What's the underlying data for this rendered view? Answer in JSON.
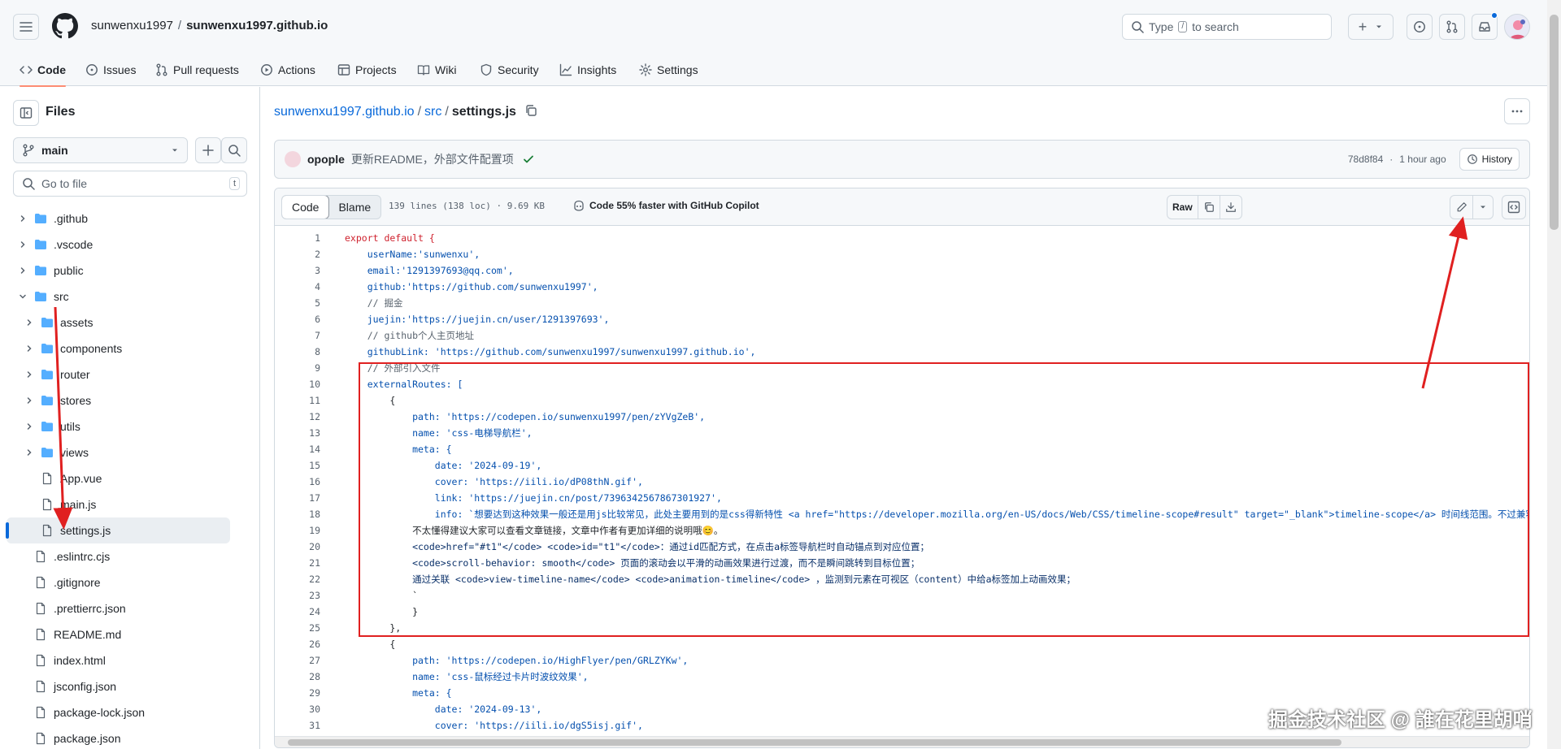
{
  "header": {
    "owner": "sunwenxu1997",
    "separator": "/",
    "repo": "sunwenxu1997.github.io",
    "search_placeholder_before": "Type",
    "search_key": "/",
    "search_placeholder_after": "to search",
    "new_button": "+"
  },
  "repo_nav": {
    "tabs": [
      {
        "label": "Code",
        "icon": "code-icon"
      },
      {
        "label": "Issues",
        "icon": "issue-icon"
      },
      {
        "label": "Pull requests",
        "icon": "pull-request-icon"
      },
      {
        "label": "Actions",
        "icon": "play-icon"
      },
      {
        "label": "Projects",
        "icon": "table-icon"
      },
      {
        "label": "Wiki",
        "icon": "book-icon"
      },
      {
        "label": "Security",
        "icon": "shield-icon"
      },
      {
        "label": "Insights",
        "icon": "graph-icon"
      },
      {
        "label": "Settings",
        "icon": "gear-icon"
      }
    ],
    "active": "Code"
  },
  "sidebar": {
    "title": "Files",
    "branch": "main",
    "go_to_file": "Go to file",
    "go_to_file_key": "t",
    "tree": [
      {
        "name": ".github",
        "type": "folder",
        "state": "collapsed"
      },
      {
        "name": ".vscode",
        "type": "folder",
        "state": "collapsed"
      },
      {
        "name": "public",
        "type": "folder",
        "state": "collapsed"
      },
      {
        "name": "src",
        "type": "folder",
        "state": "expanded"
      },
      {
        "name": "assets",
        "type": "folder",
        "state": "collapsed"
      },
      {
        "name": "components",
        "type": "folder",
        "state": "collapsed"
      },
      {
        "name": "router",
        "type": "folder",
        "state": "collapsed"
      },
      {
        "name": "stores",
        "type": "folder",
        "state": "collapsed"
      },
      {
        "name": "utils",
        "type": "folder",
        "state": "collapsed"
      },
      {
        "name": "views",
        "type": "folder",
        "state": "collapsed"
      },
      {
        "name": "App.vue",
        "type": "file"
      },
      {
        "name": "main.js",
        "type": "file"
      },
      {
        "name": "settings.js",
        "type": "file",
        "selected": true
      },
      {
        "name": ".eslintrc.cjs",
        "type": "file"
      },
      {
        "name": ".gitignore",
        "type": "file"
      },
      {
        "name": ".prettierrc.json",
        "type": "file"
      },
      {
        "name": "README.md",
        "type": "file"
      },
      {
        "name": "index.html",
        "type": "file"
      },
      {
        "name": "jsconfig.json",
        "type": "file"
      },
      {
        "name": "package-lock.json",
        "type": "file"
      },
      {
        "name": "package.json",
        "type": "file"
      }
    ]
  },
  "main": {
    "path": {
      "root": "sunwenxu1997.github.io",
      "dir": "src",
      "file": "settings.js",
      "sep": "/"
    },
    "commit": {
      "author": "opople",
      "message": "更新README，外部文件配置项",
      "hash": "78d8f84",
      "dot": "·",
      "time": "1 hour ago",
      "history": "History"
    },
    "file": {
      "tab_code": "Code",
      "tab_blame": "Blame",
      "info": "139 lines (138 loc) · 9.69 KB",
      "copilot": "Code 55% faster with GitHub Copilot",
      "raw": "Raw"
    },
    "code_lines": [
      {
        "n": "1",
        "t": "export default {"
      },
      {
        "n": "2",
        "t": "    userName:'sunwenxu',"
      },
      {
        "n": "3",
        "t": "    email:'1291397693@qq.com',"
      },
      {
        "n": "4",
        "t": "    github:'https://github.com/sunwenxu1997',"
      },
      {
        "n": "5",
        "t": "    // 掘金"
      },
      {
        "n": "6",
        "t": "    juejin:'https://juejin.cn/user/1291397693',"
      },
      {
        "n": "7",
        "t": "    // github个人主页地址"
      },
      {
        "n": "8",
        "t": "    githubLink: 'https://github.com/sunwenxu1997/sunwenxu1997.github.io',"
      },
      {
        "n": "9",
        "t": "    // 外部引入文件"
      },
      {
        "n": "10",
        "t": "    externalRoutes: ["
      },
      {
        "n": "11",
        "t": "        {"
      },
      {
        "n": "12",
        "t": "            path: 'https://codepen.io/sunwenxu1997/pen/zYVgZeB',"
      },
      {
        "n": "13",
        "t": "            name: 'css-电梯导航栏',"
      },
      {
        "n": "14",
        "t": "            meta: {"
      },
      {
        "n": "15",
        "t": "                date: '2024-09-19',"
      },
      {
        "n": "16",
        "t": "                cover: 'https://iili.io/dP08thN.gif',"
      },
      {
        "n": "17",
        "t": "                link: 'https://juejin.cn/post/7396342567867301927',"
      },
      {
        "n": "18",
        "t": "                info: `想要达到这种效果一般还是用js比较常见，此处主要用到的是css得新特性 <a href=\"https://developer.mozilla.org/en-US/docs/Web/CSS/timeline-scope#result\" target=\"_blank\">timeline-scope</a> 时间线范围。不过兼容性"
      },
      {
        "n": "19",
        "t": "            不太懂得建议大家可以查看文章链接，文章中作者有更加详细的说明哦😊。"
      },
      {
        "n": "20",
        "t": "            <code>href=\"#t1\"</code> <code>id=\"t1\"</code>：通过id匹配方式，在点击a标签导航栏时自动锚点到对应位置；"
      },
      {
        "n": "21",
        "t": "            <code>scroll-behavior: smooth</code> 页面的滚动会以平滑的动画效果进行过渡，而不是瞬间跳转到目标位置；"
      },
      {
        "n": "22",
        "t": "            通过关联 <code>view-timeline-name</code> <code>animation-timeline</code> ，监测到元素在可视区（content）中给a标签加上动画效果；"
      },
      {
        "n": "23",
        "t": "            `"
      },
      {
        "n": "24",
        "t": "            }"
      },
      {
        "n": "25",
        "t": "        },"
      },
      {
        "n": "26",
        "t": "        {"
      },
      {
        "n": "27",
        "t": "            path: 'https://codepen.io/HighFlyer/pen/GRLZYKw',"
      },
      {
        "n": "28",
        "t": "            name: 'css-鼠标经过卡片时波纹效果',"
      },
      {
        "n": "29",
        "t": "            meta: {"
      },
      {
        "n": "30",
        "t": "                date: '2024-09-13',"
      },
      {
        "n": "31",
        "t": "                cover: 'https://iili.io/dgS5isj.gif',"
      }
    ]
  },
  "watermark": "掘金技术社区 @ 誰在花里胡哨",
  "colors": {
    "accent": "#0969da",
    "annotation_red": "#e02020",
    "active_tab_underline": "#fd8c73"
  }
}
